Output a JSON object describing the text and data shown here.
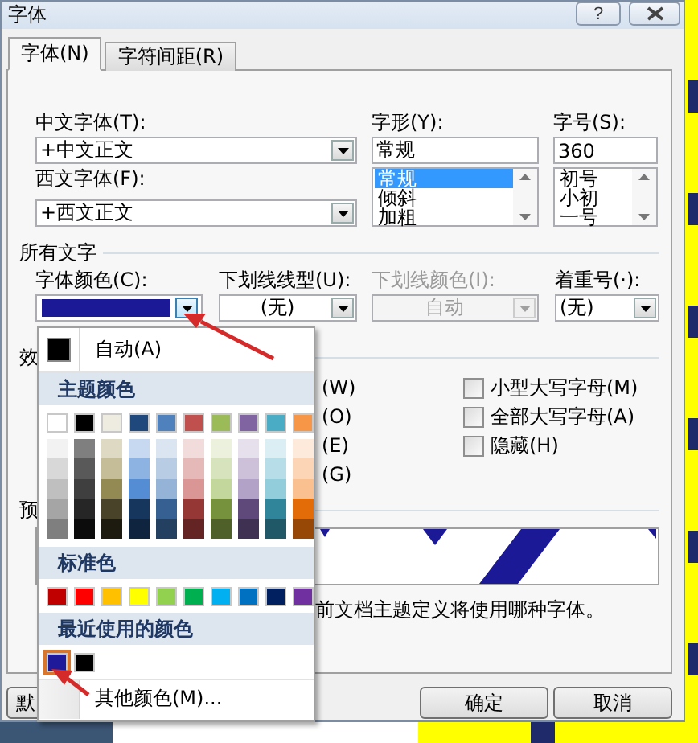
{
  "window": {
    "title": "字体",
    "help": "?"
  },
  "tabs": [
    {
      "label": "字体(N)",
      "selected": true
    },
    {
      "label": "字符间距(R)",
      "selected": false
    }
  ],
  "fonts": {
    "chinese": {
      "label": "中文字体(T):",
      "value": "+中文正文"
    },
    "western": {
      "label": "西文字体(F):",
      "value": "+西文正文"
    },
    "style": {
      "label": "字形(Y):",
      "value": "常规",
      "options": [
        {
          "label": "常规",
          "selected": true
        },
        {
          "label": "倾斜",
          "selected": false
        },
        {
          "label": "加粗",
          "selected": false
        }
      ]
    },
    "size": {
      "label": "字号(S):",
      "value": "360",
      "options": [
        {
          "label": "初号",
          "selected": false
        },
        {
          "label": "小初",
          "selected": false
        },
        {
          "label": "一号",
          "selected": false
        }
      ]
    }
  },
  "all_text": {
    "title": "所有文字",
    "font_color": {
      "label": "字体颜色(C):",
      "color": "#1c1996"
    },
    "underline_style": {
      "label": "下划线线型(U):",
      "value": "(无)",
      "disabled": false
    },
    "underline_color": {
      "label": "下划线颜色(I):",
      "value": "自动",
      "disabled": true
    },
    "emphasis": {
      "label": "着重号(·):",
      "value": "(无)",
      "disabled": false
    }
  },
  "effects": {
    "title": "效",
    "left": [
      "(W)",
      "(O)",
      "(E)",
      "(G)"
    ],
    "right": [
      {
        "label": "小型大写字母(M)",
        "checked": false
      },
      {
        "label": "全部大写字母(A)",
        "checked": false
      },
      {
        "label": "隐藏(H)",
        "checked": false
      }
    ]
  },
  "preview": {
    "title": "预",
    "note": "前文档主题定义将使用哪种字体。"
  },
  "buttons": [
    {
      "label": "默"
    },
    {
      "label": "确定"
    },
    {
      "label": "取消"
    }
  ],
  "color_menu": {
    "auto": {
      "label": "自动(A)",
      "color": "#000000"
    },
    "sections": [
      {
        "title": "主题颜色",
        "kind": "theme",
        "colors": [
          {
            "color": "#ffffff",
            "shades": [
              {
                "color": "#f2f2f2"
              },
              {
                "color": "#d8d8d8"
              },
              {
                "color": "#bfbfbf"
              },
              {
                "color": "#a5a5a5"
              },
              {
                "color": "#7f7f7f"
              }
            ]
          },
          {
            "color": "#000000",
            "shades": [
              {
                "color": "#7f7f7f"
              },
              {
                "color": "#595959"
              },
              {
                "color": "#3f3f3f"
              },
              {
                "color": "#262626"
              },
              {
                "color": "#0c0c0c"
              }
            ]
          },
          {
            "color": "#eeece1",
            "shades": [
              {
                "color": "#ddd9c3"
              },
              {
                "color": "#c4bd97"
              },
              {
                "color": "#938953"
              },
              {
                "color": "#494429"
              },
              {
                "color": "#1d1b10"
              }
            ]
          },
          {
            "color": "#1f497d",
            "shades": [
              {
                "color": "#c6d9f0"
              },
              {
                "color": "#8db3e2"
              },
              {
                "color": "#548dd4"
              },
              {
                "color": "#17365d"
              },
              {
                "color": "#0f243e"
              }
            ]
          },
          {
            "color": "#4f81bd",
            "shades": [
              {
                "color": "#dbe5f1"
              },
              {
                "color": "#b8cce4"
              },
              {
                "color": "#95b3d7"
              },
              {
                "color": "#366092"
              },
              {
                "color": "#244061"
              }
            ]
          },
          {
            "color": "#c0504d",
            "shades": [
              {
                "color": "#f2dcdb"
              },
              {
                "color": "#e5b9b7"
              },
              {
                "color": "#d99694"
              },
              {
                "color": "#953734"
              },
              {
                "color": "#632423"
              }
            ]
          },
          {
            "color": "#9bbb59",
            "shades": [
              {
                "color": "#ebf1dd"
              },
              {
                "color": "#d7e3bc"
              },
              {
                "color": "#c3d69b"
              },
              {
                "color": "#76923c"
              },
              {
                "color": "#4f6128"
              }
            ]
          },
          {
            "color": "#8064a2",
            "shades": [
              {
                "color": "#e5e0ec"
              },
              {
                "color": "#ccc1d9"
              },
              {
                "color": "#b2a2c7"
              },
              {
                "color": "#5f497a"
              },
              {
                "color": "#3f3151"
              }
            ]
          },
          {
            "color": "#4bacc6",
            "shades": [
              {
                "color": "#dbeef3"
              },
              {
                "color": "#b7dde8"
              },
              {
                "color": "#92cddc"
              },
              {
                "color": "#31859b"
              },
              {
                "color": "#205867"
              }
            ]
          },
          {
            "color": "#f79646",
            "shades": [
              {
                "color": "#fdeada"
              },
              {
                "color": "#fbd5b5"
              },
              {
                "color": "#fac08f"
              },
              {
                "color": "#e36c09"
              },
              {
                "color": "#974806"
              }
            ]
          }
        ]
      },
      {
        "title": "标准色",
        "kind": "standard",
        "colors": [
          {
            "color": "#c00000"
          },
          {
            "color": "#ff0000"
          },
          {
            "color": "#ffc000"
          },
          {
            "color": "#ffff00"
          },
          {
            "color": "#92d050"
          },
          {
            "color": "#00b050"
          },
          {
            "color": "#00b0f0"
          },
          {
            "color": "#0070c0"
          },
          {
            "color": "#002060"
          },
          {
            "color": "#7030a0"
          }
        ]
      },
      {
        "title": "最近使用的颜色",
        "kind": "recent",
        "colors": [
          {
            "color": "#1f1a99",
            "selected": true
          },
          {
            "color": "#000000",
            "selected": false
          }
        ]
      }
    ],
    "more": "其他颜色(M)..."
  }
}
